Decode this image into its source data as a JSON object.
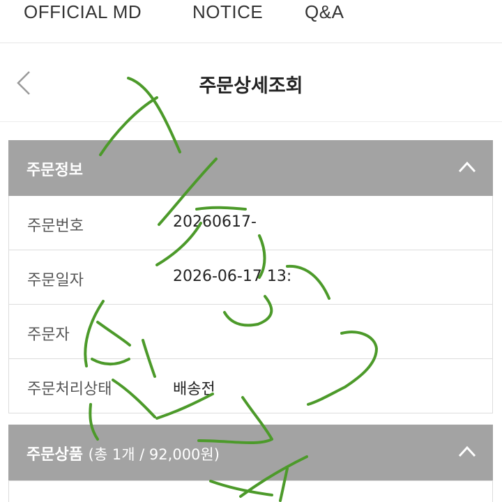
{
  "nav": {
    "items": [
      "OFFICIAL MD",
      "NOTICE",
      "Q&A"
    ]
  },
  "header": {
    "title": "주문상세조회",
    "back_icon": "chevron-left-icon"
  },
  "order_info": {
    "title": "주문정보",
    "toggle_icon": "chevron-up-icon",
    "rows": [
      {
        "label": "주문번호",
        "value": "20260617-"
      },
      {
        "label": "주문일자",
        "value": "2026-06-17 13:"
      },
      {
        "label": "주문자",
        "value": ""
      },
      {
        "label": "주문처리상태",
        "value": "배송전"
      }
    ]
  },
  "order_products": {
    "title": "주문상품",
    "summary": "(총 1개 / 92,000원)",
    "toggle_icon": "chevron-up-icon"
  },
  "colors": {
    "section_header": "#a3a3a3",
    "scribble": "#4c9a2a"
  }
}
